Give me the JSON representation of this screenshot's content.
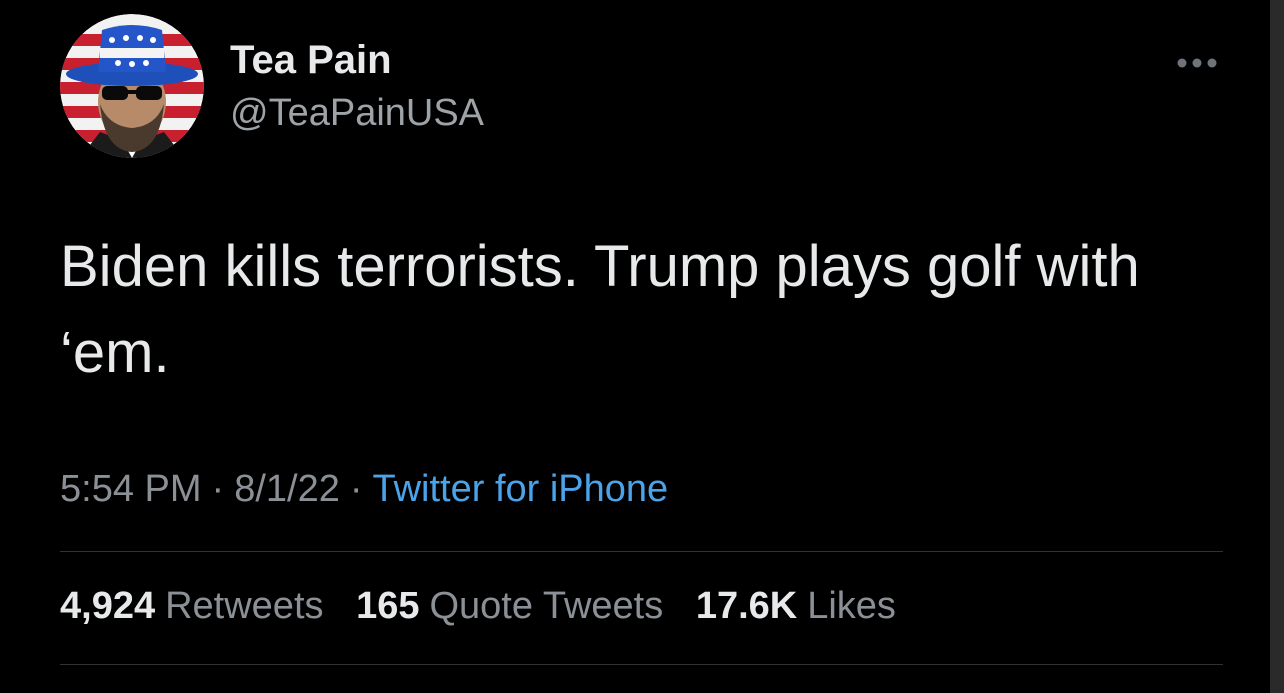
{
  "user": {
    "display_name": "Tea Pain",
    "handle": "@TeaPainUSA",
    "avatar_icon": "avatar-uncle-sam-hat-sunglasses"
  },
  "tweet": {
    "text": "Biden kills terrorists.  Trump plays golf with ‘em.",
    "time": "5:54 PM",
    "date": "8/1/22",
    "source": "Twitter for iPhone",
    "separator": "·"
  },
  "stats": {
    "retweets_count": "4,924",
    "retweets_label": "Retweets",
    "quotes_count": "165",
    "quotes_label": "Quote Tweets",
    "likes_count": "17.6K",
    "likes_label": "Likes"
  },
  "menu": {
    "more_icon": "more-horizontal-icon"
  },
  "colors": {
    "background": "#000000",
    "text": "#e7e9ea",
    "secondary": "#8b9096",
    "link": "#4ba3ea",
    "divider": "#2f3336"
  }
}
